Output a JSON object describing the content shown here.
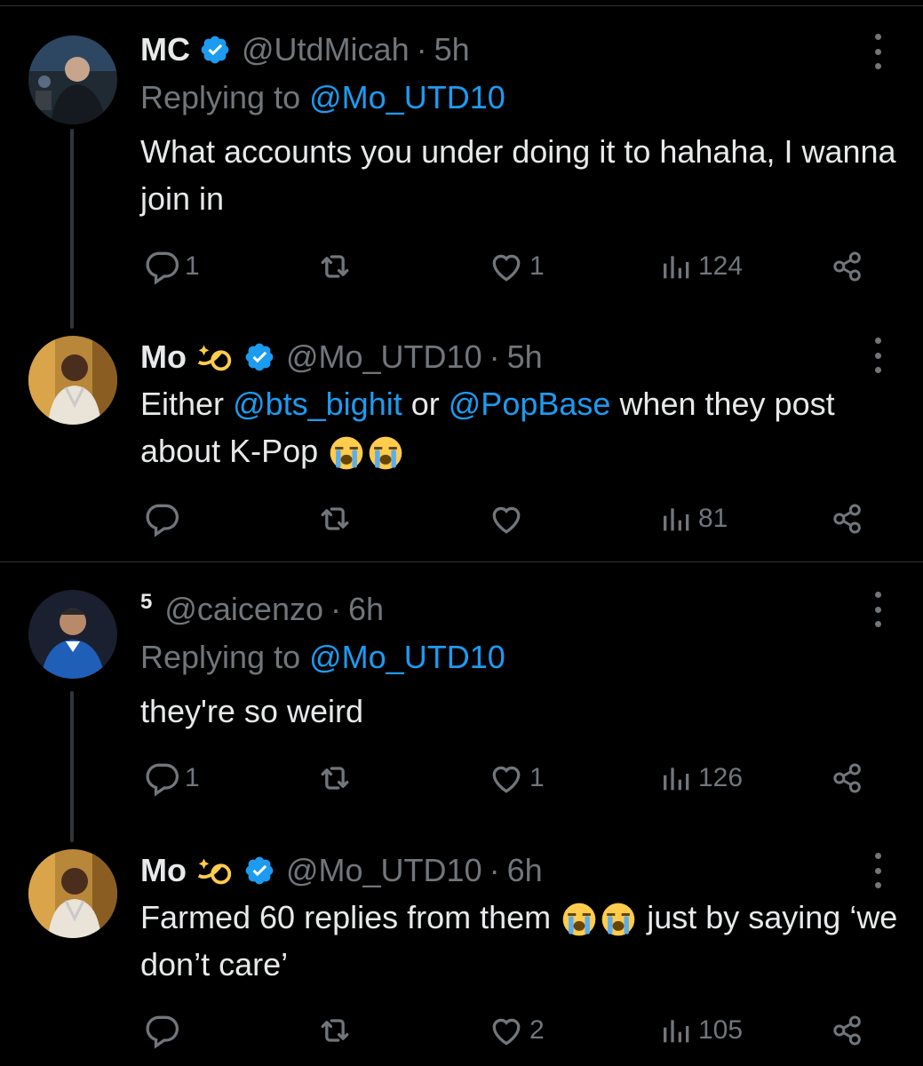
{
  "tweets": [
    {
      "name": "MC",
      "handle": "@UtdMicah",
      "dot": "·",
      "time": "5h",
      "verified": true,
      "reply_prefix": "Replying to",
      "reply_to": "@Mo_UTD10",
      "text": "What accounts you under doing it to hahaha, I wanna join in",
      "reply_count": "1",
      "retweet_count": "",
      "like_count": "1",
      "view_count": "124"
    },
    {
      "name": "Mo",
      "handle": "@Mo_UTD10",
      "dot": "·",
      "time": "5h",
      "verified": true,
      "name_emoji": "dizzy",
      "text_parts": [
        "Either",
        "@bts_bighit",
        "or",
        "@PopBase",
        "when they post about K-Pop"
      ],
      "text_emoji": "loudly-crying-face x2",
      "reply_count": "",
      "retweet_count": "",
      "like_count": "",
      "view_count": "81"
    },
    {
      "name": "5",
      "handle": "@caicenzo",
      "dot": "·",
      "time": "6h",
      "verified": false,
      "reply_prefix": "Replying to",
      "reply_to": "@Mo_UTD10",
      "text": "they're so weird",
      "reply_count": "1",
      "retweet_count": "",
      "like_count": "1",
      "view_count": "126"
    },
    {
      "name": "Mo",
      "handle": "@Mo_UTD10",
      "dot": "·",
      "time": "6h",
      "verified": true,
      "name_emoji": "dizzy",
      "text_before": "Farmed 60 replies from them",
      "text_after": "just by saying ‘we don’t care’",
      "text_emoji": "loudly-crying-face x2",
      "reply_count": "",
      "retweet_count": "",
      "like_count": "2",
      "view_count": "105"
    }
  ],
  "colors": {
    "background": "#000000",
    "text": "#e7e9ea",
    "muted": "#71767b",
    "link": "#1d9bf0",
    "verified": "#1d9bf0"
  },
  "icons": [
    "reply-icon",
    "retweet-icon",
    "like-icon",
    "views-icon",
    "share-icon",
    "more-icon",
    "verified-badge-icon"
  ]
}
